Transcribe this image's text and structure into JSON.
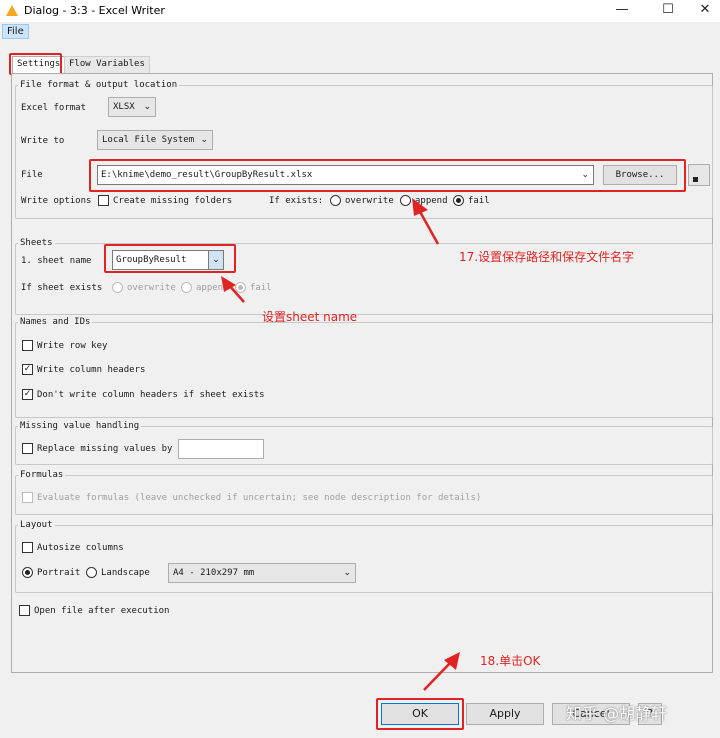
{
  "window": {
    "title": "Dialog - 3:3 - Excel Writer",
    "minimize": "—",
    "maximize": "☐",
    "close": "✕"
  },
  "menu": {
    "file": "File"
  },
  "tabs": {
    "settings": "Settings",
    "flow_variables": "Flow Variables"
  },
  "file_format": {
    "group_title": "File format & output location",
    "excel_format_label": "Excel format",
    "excel_format_value": "XLSX",
    "write_to_label": "Write to",
    "write_to_value": "Local File System",
    "file_label": "File",
    "file_value": "E:\\knime\\demo_result\\GroupByResult.xlsx",
    "browse_label": "Browse...",
    "write_options_label": "Write options",
    "create_missing_folders_label": "Create missing folders",
    "create_missing_folders_checked": false,
    "if_exists_label": "If exists:",
    "if_exists_options": [
      "overwrite",
      "append",
      "fail"
    ],
    "if_exists_selected": "fail"
  },
  "sheets": {
    "group_title": "Sheets",
    "sheet_name_label": "1. sheet name",
    "sheet_name_value": "GroupByResult",
    "if_sheet_exists_label": "If sheet exists",
    "if_sheet_exists_options": [
      "overwrite",
      "append",
      "fail"
    ],
    "if_sheet_exists_selected": "fail"
  },
  "names_ids": {
    "group_title": "Names and IDs",
    "write_row_key": "Write row key",
    "write_row_key_checked": false,
    "write_column_headers": "Write column headers",
    "write_column_headers_checked": true,
    "dont_write_headers": "Don't write column headers if sheet exists",
    "dont_write_headers_checked": true
  },
  "missing": {
    "group_title": "Missing value handling",
    "replace_label": "Replace missing values by",
    "replace_checked": false,
    "replace_value": ""
  },
  "formulas": {
    "group_title": "Formulas",
    "evaluate_label": "Evaluate formulas (leave unchecked if uncertain; see node description for details)",
    "evaluate_checked": false
  },
  "layout": {
    "group_title": "Layout",
    "autosize_label": "Autosize columns",
    "autosize_checked": false,
    "portrait_label": "Portrait",
    "landscape_label": "Landscape",
    "orientation_selected": "Portrait",
    "paper_size_value": "A4 - 210x297 mm"
  },
  "open_after": {
    "label": "Open file after execution",
    "checked": false
  },
  "buttons": {
    "ok": "OK",
    "apply": "Apply",
    "cancel": "Cancel",
    "help": "?"
  },
  "annotations": {
    "step17": "17.设置保存路径和保存文件名字",
    "sheet_note": "设置sheet name",
    "step18": "18.单击OK"
  },
  "watermark": "知乎 @胡静轩",
  "colors": {
    "highlight": "#e02424",
    "selection": "#cce4f7"
  },
  "icons": {
    "app": "knime-node-icon",
    "flow_variable": "flow-variable-icon"
  }
}
